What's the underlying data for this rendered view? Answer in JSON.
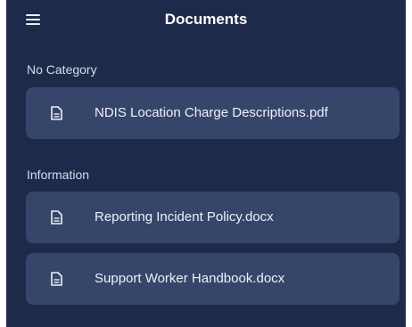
{
  "header": {
    "title": "Documents",
    "menu_icon": "hamburger-menu-icon"
  },
  "sections": [
    {
      "label": "No Category",
      "documents": [
        {
          "name": "NDIS Location Charge Descriptions.pdf",
          "icon": "document-icon"
        }
      ]
    },
    {
      "label": "Information",
      "documents": [
        {
          "name": "Reporting Incident Policy.docx",
          "icon": "document-icon"
        },
        {
          "name": "Support Worker Handbook.docx",
          "icon": "document-icon"
        }
      ]
    }
  ],
  "colors": {
    "background": "#1e2a4a",
    "card": "#36456a",
    "text": "#eef1f7",
    "label": "#d6dcea"
  }
}
